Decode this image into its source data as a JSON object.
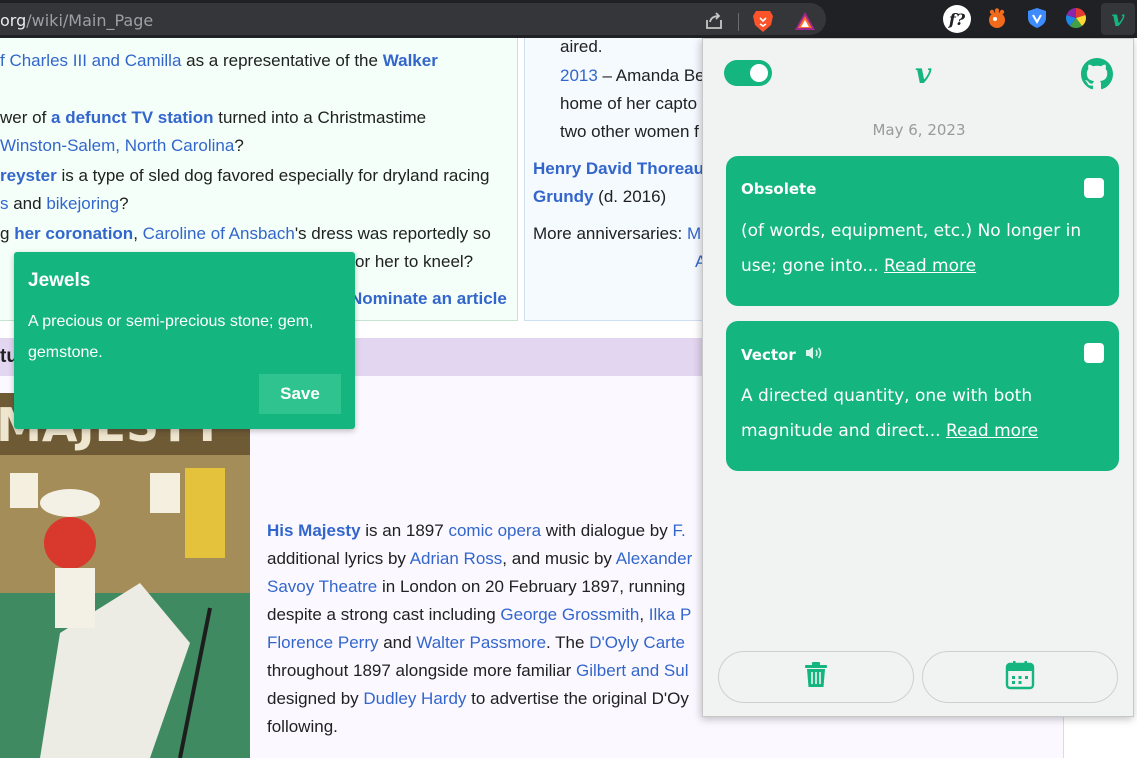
{
  "browser": {
    "url_domain": "org",
    "url_path": "/wiki/Main_Page"
  },
  "wiki": {
    "dyk": [
      {
        "parts": [
          {
            "t": "f Charles III and Camilla",
            "c": "wl"
          },
          {
            "t": " as a representative of the ",
            "c": ""
          },
          {
            "t": "Walker",
            "c": "wlb"
          }
        ]
      },
      {
        "parts": [
          {
            "t": "wer of ",
            "c": ""
          },
          {
            "t": "a defunct TV station",
            "c": "wlb"
          },
          {
            "t": " turned into a Christmastime",
            "c": ""
          }
        ]
      },
      {
        "parts": [
          {
            "t": "Winston-Salem, North Carolina",
            "c": "wl"
          },
          {
            "t": "?",
            "c": ""
          }
        ]
      },
      {
        "parts": [
          {
            "t": "reyster",
            "c": "wlb"
          },
          {
            "t": " is a type of sled dog favored especially for dryland racing",
            "c": ""
          }
        ]
      },
      {
        "parts": [
          {
            "t": "s",
            "c": "wl"
          },
          {
            "t": " and ",
            "c": ""
          },
          {
            "t": "bikejoring",
            "c": "wl"
          },
          {
            "t": "?",
            "c": ""
          }
        ]
      },
      {
        "parts": [
          {
            "t": "g ",
            "c": ""
          },
          {
            "t": "her coronation",
            "c": "wlb"
          },
          {
            "t": ", ",
            "c": ""
          },
          {
            "t": "Caroline of Ansbach",
            "c": "wl"
          },
          {
            "t": "'s dress was reportedly so",
            "c": ""
          }
        ]
      },
      {
        "parts": [
          {
            "t": "or her to kneel?",
            "c": ""
          }
        ]
      },
      {
        "parts": [
          {
            "t": "Nominate an article",
            "c": "wlb"
          }
        ]
      }
    ],
    "otd": [
      {
        "parts": [
          {
            "t": "aired.",
            "c": ""
          }
        ]
      },
      {
        "parts": [
          {
            "t": "2013",
            "c": "wl"
          },
          {
            "t": " – Amanda Be",
            "c": ""
          }
        ]
      },
      {
        "parts": [
          {
            "t": "home of her capto",
            "c": ""
          }
        ]
      },
      {
        "parts": [
          {
            "t": "two other women f",
            "c": ""
          }
        ]
      },
      {
        "parts": [
          {
            "t": "Henry David Thoreau",
            "c": "wlb"
          }
        ]
      },
      {
        "parts": [
          {
            "t": "Grundy",
            "c": "wlb"
          },
          {
            "t": " (d. 2016)",
            "c": ""
          }
        ]
      },
      {
        "parts": [
          {
            "t": "More anniversaries: ",
            "c": ""
          },
          {
            "t": "M",
            "c": "wl"
          }
        ]
      },
      {
        "parts": [
          {
            "t": "A",
            "c": "wl"
          }
        ]
      }
    ],
    "tfa_heading": "tu",
    "tfa": [
      {
        "parts": [
          {
            "t": "His Majesty",
            "c": "wlb"
          },
          {
            "t": " is an 1897 ",
            "c": ""
          },
          {
            "t": "comic opera",
            "c": "wl"
          },
          {
            "t": " with dialogue by ",
            "c": ""
          },
          {
            "t": "F.",
            "c": "wl"
          }
        ]
      },
      {
        "parts": [
          {
            "t": "additional lyrics by ",
            "c": ""
          },
          {
            "t": "Adrian Ross",
            "c": "wl"
          },
          {
            "t": ", and music by ",
            "c": ""
          },
          {
            "t": "Alexander",
            "c": "wl"
          }
        ]
      },
      {
        "parts": [
          {
            "t": "Savoy Theatre",
            "c": "wl"
          },
          {
            "t": " in London on 20 February 1897, running",
            "c": ""
          }
        ]
      },
      {
        "parts": [
          {
            "t": "despite a strong cast including ",
            "c": ""
          },
          {
            "t": "George Grossmith",
            "c": "wl"
          },
          {
            "t": ", ",
            "c": ""
          },
          {
            "t": "Ilka P",
            "c": "wl"
          }
        ]
      },
      {
        "parts": [
          {
            "t": "Florence Perry",
            "c": "wl"
          },
          {
            "t": " and ",
            "c": ""
          },
          {
            "t": "Walter Passmore",
            "c": "wl"
          },
          {
            "t": ". The ",
            "c": ""
          },
          {
            "t": "D'Oyly Carte",
            "c": "wl"
          }
        ]
      },
      {
        "parts": [
          {
            "t": "throughout 1897 alongside more familiar ",
            "c": ""
          },
          {
            "t": "Gilbert and Sul",
            "c": "wl"
          }
        ]
      },
      {
        "parts": [
          {
            "t": "designed by ",
            "c": ""
          },
          {
            "t": "Dudley Hardy",
            "c": "wl"
          },
          {
            "t": " to advertise the original D'Oy",
            "c": ""
          }
        ]
      },
      {
        "parts": [
          {
            "t": "following.",
            "c": ""
          }
        ]
      }
    ],
    "poster_text": "MAJESTY"
  },
  "tooltip": {
    "title": "Jewels",
    "definition": "A precious or semi-precious stone; gem, gemstone.",
    "save_label": "Save"
  },
  "popup": {
    "brand": "v",
    "date": "May 6, 2023",
    "cards": [
      {
        "word": "Obsolete",
        "definition": "(of words, equipment, etc.) No longer in use; gone into...",
        "read_more": "Read more",
        "has_audio": false
      },
      {
        "word": "Vector",
        "definition": "A directed quantity, one with both magnitude and direct...",
        "read_more": "Read more",
        "has_audio": true
      }
    ]
  },
  "colors": {
    "accent": "#15b57f",
    "link": "#3366cc",
    "toolbar": "#202124"
  },
  "icons": {
    "share": "share-icon",
    "brave": "brave-lion-icon",
    "rewards": "brave-rewards-icon",
    "f": "f-question-extension-icon",
    "hand": "hand-extension-icon",
    "shield": "shield-extension-icon",
    "palette": "color-wheel-extension-icon",
    "vocab": "v-extension-icon",
    "github": "github-icon",
    "trash": "trash-icon",
    "calendar": "calendar-icon",
    "speaker": "speaker-icon"
  }
}
